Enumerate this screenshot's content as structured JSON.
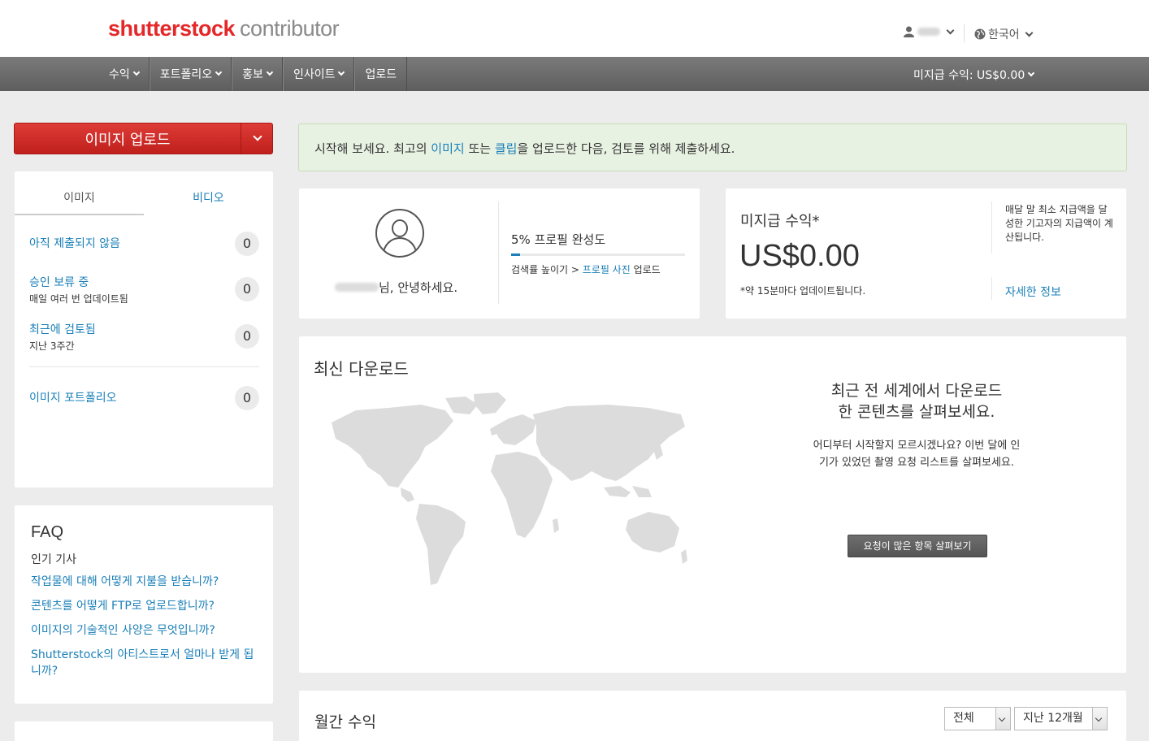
{
  "header": {
    "brand": "shutterstock",
    "brand_sub": "contributor",
    "language": "한국어"
  },
  "nav": {
    "items": [
      {
        "label": "수익",
        "has_menu": true
      },
      {
        "label": "포트폴리오",
        "has_menu": true
      },
      {
        "label": "홍보",
        "has_menu": true
      },
      {
        "label": "인사이트",
        "has_menu": true
      },
      {
        "label": "업로드",
        "has_menu": false
      }
    ],
    "unpaid_earnings": "미지급 수익: US$0.00"
  },
  "upload_button": {
    "label": "이미지 업로드"
  },
  "status_panel": {
    "tabs": [
      {
        "label": "이미지"
      },
      {
        "label": "비디오"
      }
    ],
    "rows": [
      {
        "title": "아직 제출되지 않음",
        "desc": "",
        "count": "0"
      },
      {
        "title": "승인 보류 중",
        "desc": "매일 여러 번 업데이트됨",
        "count": "0"
      },
      {
        "title": "최근에 검토됨",
        "desc": "지난 3주간",
        "count": "0"
      },
      {
        "title": "이미지 포트폴리오",
        "desc": "",
        "count": "0"
      }
    ]
  },
  "faq": {
    "title": "FAQ",
    "subtitle": "인기 기사",
    "links": [
      "작업물에 대해 어떻게 지불을 받습니까?",
      "콘텐츠를 어떻게 FTP로 업로드합니까?",
      "이미지의 기술적인 사양은 무엇입니까?",
      "Shutterstock의 아티스트로서 얼마나 받게 됩니까?"
    ]
  },
  "alert": {
    "prefix": "시작해 보세요. 최고의 ",
    "link1": "이미지",
    "mid": " 또는 ",
    "link2": "클립",
    "suffix": "을 업로드한 다음, 검토를 위해 제출하세요."
  },
  "profile": {
    "greeting_suffix": "님, 안녕하세요.",
    "completion_label": "5% 프로필 완성도",
    "completion_percent": 5,
    "tip_prefix": "검색률 높이기 > ",
    "tip_link": "프로필 사진",
    "tip_suffix": " 업로드"
  },
  "earnings": {
    "title": "미지급 수익*",
    "amount": "US$0.00",
    "note": "*약 15분마다 업데이트됩니다.",
    "info": "매달 말 최소 지급액을 달성한 기고자의 지급액이 계산됩니다.",
    "more_link": "자세한 정보"
  },
  "downloads": {
    "title": "최신 다운로드",
    "headline_line1": "최근 전 세계에서 다운로드",
    "headline_line2": "한 콘텐츠를 살펴보세요.",
    "desc": "어디부터 시작할지 모르시겠나요? 이번 달에 인기가 있었던 촬영 요청 리스트를 살펴보세요.",
    "button": "요청이 많은 항목 살펴보기"
  },
  "monthly": {
    "title": "월간 수익",
    "filter_type": "전체",
    "filter_range": "지난 12개월"
  },
  "colors": {
    "brand_red": "#e4282a",
    "link_blue": "#1a7fb8",
    "nav_gray": "#6b6b6b",
    "alert_green": "#e8f2e2"
  }
}
